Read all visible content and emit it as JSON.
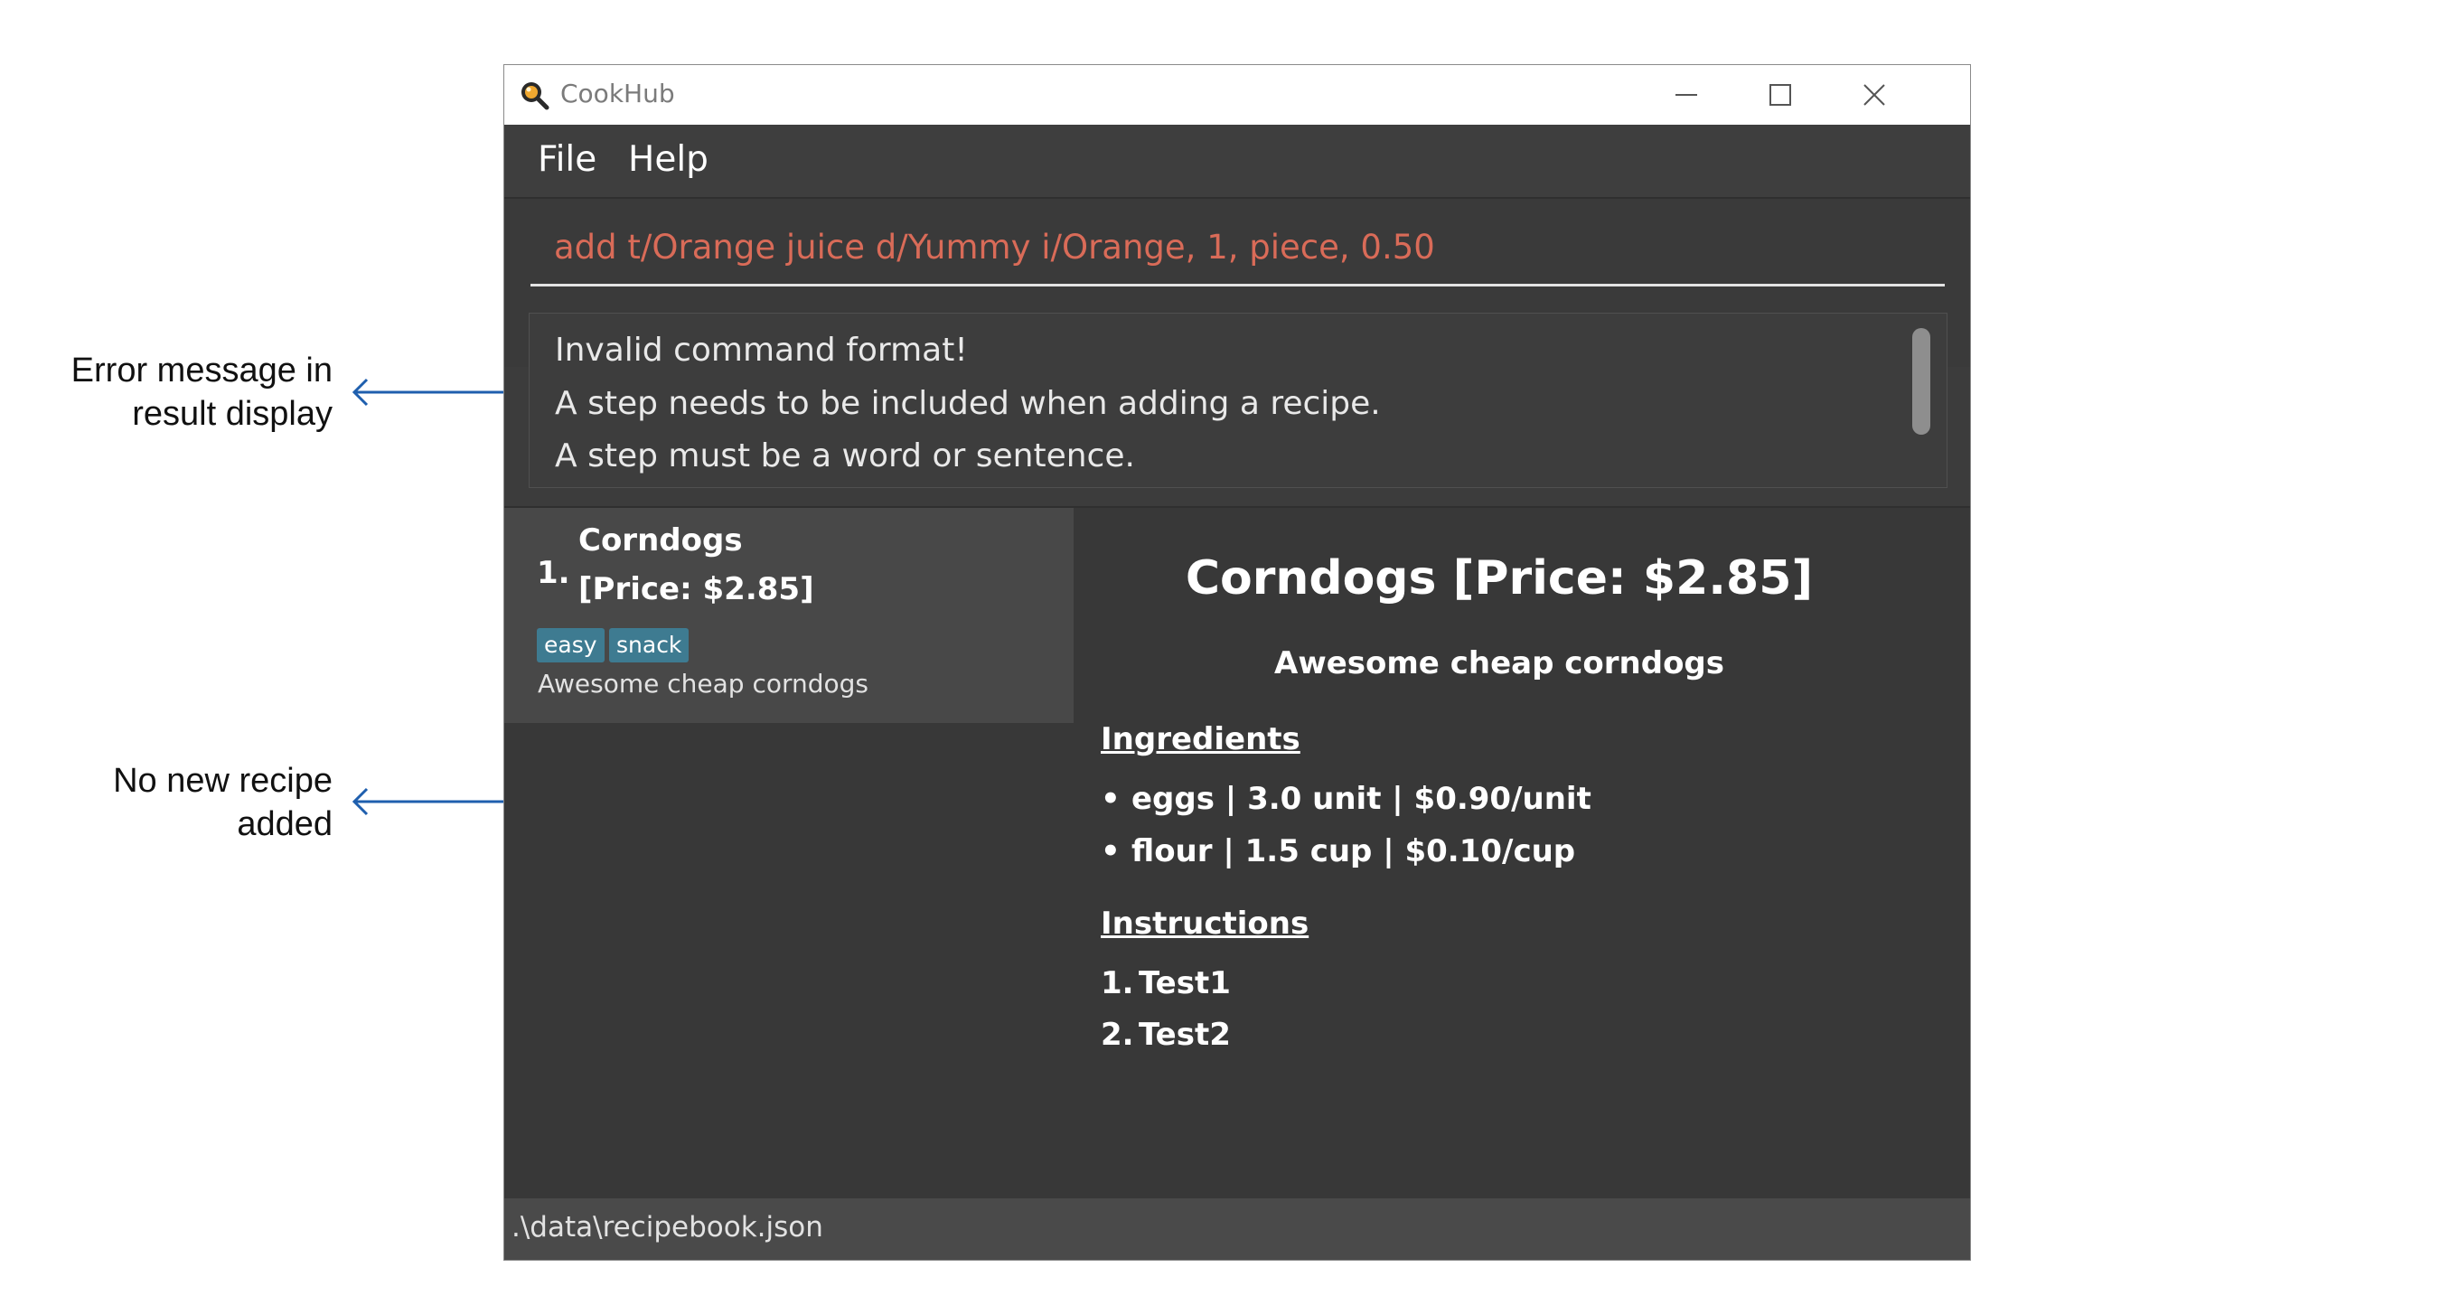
{
  "annotations": {
    "error_note": [
      "Error message in",
      "result display"
    ],
    "recipe_note": [
      "No new recipe",
      "added"
    ]
  },
  "window": {
    "title": "CookHub",
    "icon": "magnifier-app-icon",
    "controls": [
      "minimize-icon",
      "maximize-icon",
      "close-icon"
    ]
  },
  "menu": {
    "items": [
      "File",
      "Help"
    ]
  },
  "command_box": {
    "value": "add t/Orange juice d/Yummy i/Orange, 1, piece, 0.50",
    "text_color": "#d96b58"
  },
  "result_display": {
    "lines": [
      "Invalid command format!",
      "A step needs to be included when adding a recipe.",
      "A step must be a word or sentence."
    ]
  },
  "recipe_list": {
    "items": [
      {
        "index": "1.",
        "name": "Corndogs",
        "price": "[Price: $2.85]",
        "tags": [
          "easy",
          "snack"
        ],
        "description": "Awesome cheap corndogs"
      }
    ]
  },
  "recipe_detail": {
    "title": "Corndogs [Price: $2.85]",
    "description": "Awesome cheap corndogs",
    "ingredients_heading": "Ingredients",
    "ingredients": [
      "eggs | 3.0 unit | $0.90/unit",
      "flour | 1.5 cup | $0.10/cup"
    ],
    "instructions_heading": "Instructions",
    "instructions": [
      {
        "num": "1.",
        "text": "Test1"
      },
      {
        "num": "2.",
        "text": "Test2"
      }
    ]
  },
  "status_bar": {
    "path": ".\\data\\recipebook.json"
  },
  "colors": {
    "window_bg": "#3c3c3c",
    "card_bg": "#484848",
    "tag_bg": "#3e7b91",
    "annotation_arrow": "#1f5fae"
  }
}
